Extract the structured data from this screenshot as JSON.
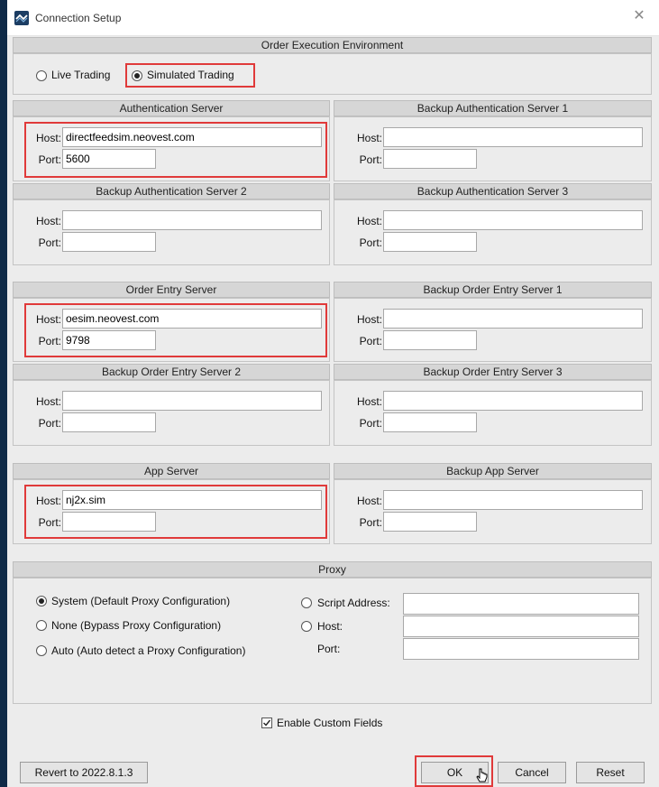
{
  "window": {
    "title": "Connection Setup"
  },
  "env": {
    "header": "Order Execution Environment",
    "options": [
      "Live Trading",
      "Simulated Trading"
    ],
    "selected": "Simulated Trading"
  },
  "labels": {
    "host": "Host:",
    "port": "Port:"
  },
  "auth": {
    "primary": {
      "title": "Authentication Server",
      "host": "directfeedsim.neovest.com",
      "port": "5600"
    },
    "backup1": {
      "title": "Backup Authentication Server 1",
      "host": "",
      "port": ""
    },
    "backup2": {
      "title": "Backup Authentication Server 2",
      "host": "",
      "port": ""
    },
    "backup3": {
      "title": "Backup Authentication Server 3",
      "host": "",
      "port": ""
    }
  },
  "order": {
    "primary": {
      "title": "Order Entry Server",
      "host": "oesim.neovest.com",
      "port": "9798"
    },
    "backup1": {
      "title": "Backup Order Entry Server 1",
      "host": "",
      "port": ""
    },
    "backup2": {
      "title": "Backup Order Entry Server 2",
      "host": "",
      "port": ""
    },
    "backup3": {
      "title": "Backup Order Entry Server 3",
      "host": "",
      "port": ""
    }
  },
  "app": {
    "primary": {
      "title": "App Server",
      "host": "nj2x.sim",
      "port": ""
    },
    "backup": {
      "title": "Backup App Server",
      "host": "",
      "port": ""
    }
  },
  "proxy": {
    "header": "Proxy",
    "system": "System (Default Proxy Configuration)",
    "none": "None (Bypass Proxy Configuration)",
    "auto": "Auto (Auto detect a Proxy Configuration)",
    "script": "Script Address:",
    "host": "Host:",
    "port": "Port:",
    "selected": "system",
    "script_value": "",
    "host_value": "",
    "port_value": ""
  },
  "custom_fields": {
    "label": "Enable Custom Fields",
    "checked": true
  },
  "buttons": {
    "revert": "Revert to 2022.8.1.3",
    "ok": "OK",
    "cancel": "Cancel",
    "reset": "Reset"
  },
  "colors": {
    "highlight": "#e03a3a",
    "header_bg": "#d6d6d6",
    "window_bg": "#ececec",
    "desktop": "#0f2a47"
  }
}
